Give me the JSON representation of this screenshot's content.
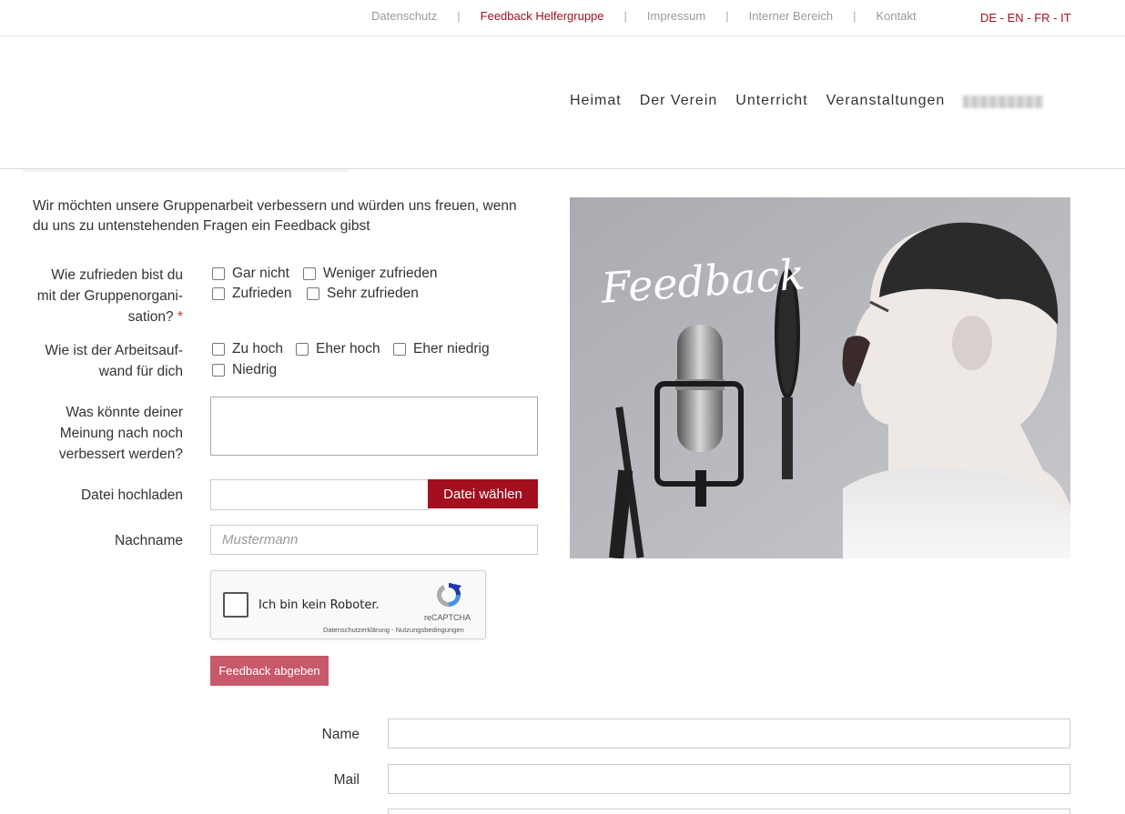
{
  "topbar": {
    "links": [
      {
        "label": "Datenschutz",
        "active": false
      },
      {
        "label": "Feedback Helfergruppe",
        "active": true
      },
      {
        "label": "Impressum",
        "active": false
      },
      {
        "label": "Interner Bereich",
        "active": false
      },
      {
        "label": "Kontakt",
        "active": false
      }
    ],
    "separator": "|",
    "languages": "DE - EN - FR - IT"
  },
  "nav": {
    "items": [
      "Heimat",
      "Der Verein",
      "Unterricht",
      "Veranstaltungen"
    ]
  },
  "intro": "Wir möchten unsere Gruppenarbeit verbessern und würden uns freuen, wenn du uns zu untenstehenden Fragen ein Feedback gibst",
  "form": {
    "q1": {
      "label_lines": [
        "Wie zufrieden bist du",
        "mit der Gruppenorgani-",
        "sation?"
      ],
      "required_mark": "*",
      "options": [
        "Gar nicht",
        "Weniger zufrieden",
        "Zufrieden",
        "Sehr zufrieden"
      ]
    },
    "q2": {
      "label_lines": [
        "Wie ist der Arbeitsauf-",
        "wand für dich"
      ],
      "options": [
        "Zu hoch",
        "Eher hoch",
        "Eher niedrig",
        "Niedrig"
      ]
    },
    "q3": {
      "label_lines": [
        "Was könnte deiner",
        "Meinung nach noch",
        "verbessert werden?"
      ],
      "value": ""
    },
    "upload": {
      "label": "Datei hochladen",
      "button": "Datei wählen"
    },
    "lastname": {
      "label": "Nachname",
      "placeholder": "Mustermann"
    },
    "captcha": {
      "text": "Ich bin kein Roboter.",
      "brand": "reCAPTCHA",
      "legal": "Datenschutzerklärung - Nutzungsbedingungen"
    },
    "submit": "Feedback abgeben"
  },
  "form2": {
    "name_label": "Name",
    "mail_label": "Mail"
  },
  "hero": {
    "script_text": "Feedback"
  },
  "colors": {
    "accent": "#a30f1e",
    "submit": "#c7596a"
  }
}
